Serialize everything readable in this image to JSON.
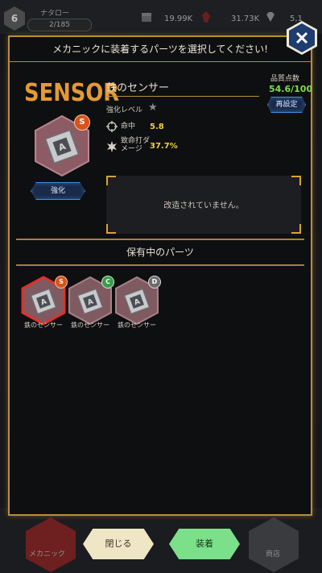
{
  "hud": {
    "level": "6",
    "player_name": "ナタロー",
    "exp": "2/185",
    "res1": "19.99K",
    "res2": "31.73K",
    "res3": "5,1"
  },
  "modal": {
    "header": "メカニックに装着するパーツを選択してください!",
    "category": "SENSOR",
    "part_name": "鉄のセンサー",
    "rank": "S",
    "enhance_level_label": "強化レベル",
    "enhance_button": "強化",
    "stats": [
      {
        "label": "命中",
        "value": "5.8",
        "icon": "crosshair-icon"
      },
      {
        "label": "致命打ダ\nメージ",
        "value": "37.7%",
        "icon": "burst-icon"
      }
    ],
    "quality_label": "品質点数",
    "quality_value": "54.6/100",
    "reset_button": "再設定",
    "modification_text": "改造されていません。",
    "owned_title": "保有中のパーツ",
    "owned_parts": [
      {
        "name": "鉄のセンサー",
        "rank": "S",
        "rank_color": "#d8531c",
        "selected": true
      },
      {
        "name": "鉄のセンサー",
        "rank": "C",
        "rank_color": "#3a9b4a",
        "selected": false
      },
      {
        "name": "鉄のセンサー",
        "rank": "D",
        "rank_color": "#6d6d6d",
        "selected": false
      }
    ]
  },
  "footer": {
    "close_label": "閉じる",
    "equip_label": "装着",
    "nav_left": "メカニック",
    "nav_right": "商店"
  },
  "colors": {
    "accent_gold": "#b98c3f",
    "category_orange": "#e39a34",
    "stat_yellow": "#f2cf3a",
    "quality_green": "#7fdc4a",
    "selected_red": "#e0302a"
  }
}
